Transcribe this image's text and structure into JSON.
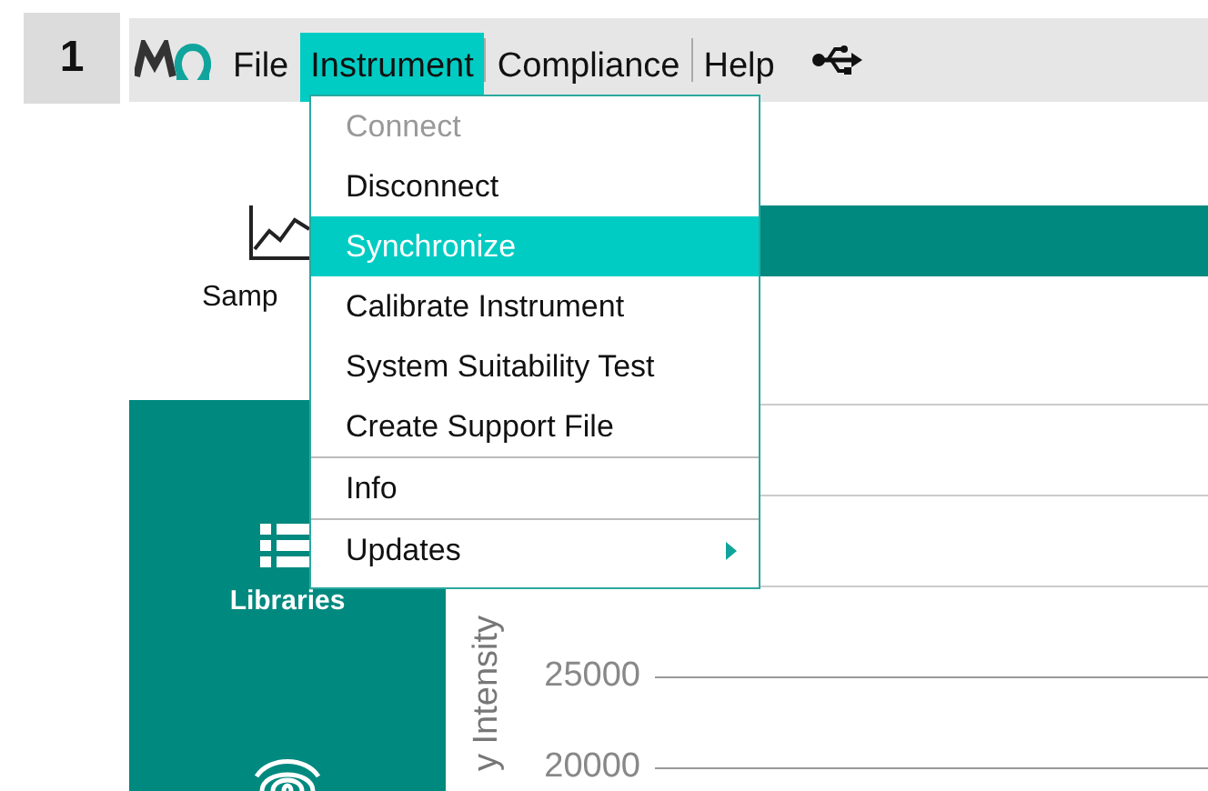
{
  "step_badge": "1",
  "menubar": {
    "items": [
      {
        "label": "File",
        "selected": false
      },
      {
        "label": "Instrument",
        "selected": true
      },
      {
        "label": "Compliance",
        "selected": false
      },
      {
        "label": "Help",
        "selected": false
      }
    ]
  },
  "dropdown": {
    "items": [
      {
        "label": "Connect",
        "disabled": true,
        "selected": false,
        "separator_before": false,
        "submenu": false
      },
      {
        "label": "Disconnect",
        "disabled": false,
        "selected": false,
        "separator_before": false,
        "submenu": false
      },
      {
        "label": "Synchronize",
        "disabled": false,
        "selected": true,
        "separator_before": false,
        "submenu": false
      },
      {
        "label": "Calibrate Instrument",
        "disabled": false,
        "selected": false,
        "separator_before": false,
        "submenu": false
      },
      {
        "label": "System Suitability Test",
        "disabled": false,
        "selected": false,
        "separator_before": false,
        "submenu": false
      },
      {
        "label": "Create Support File",
        "disabled": false,
        "selected": false,
        "separator_before": false,
        "submenu": false
      },
      {
        "label": "Info",
        "disabled": false,
        "selected": false,
        "separator_before": true,
        "submenu": false
      },
      {
        "label": "Updates",
        "disabled": false,
        "selected": false,
        "separator_before": true,
        "submenu": true
      }
    ]
  },
  "toolbar": {
    "items": [
      {
        "label": "Samp"
      }
    ]
  },
  "sidebar": {
    "items": [
      {
        "kind": "list",
        "label": "Libraries"
      },
      {
        "kind": "fingerprint"
      }
    ]
  },
  "chart": {
    "ylabel": "y Intensity",
    "yticks": [
      "25000",
      "20000"
    ]
  }
}
